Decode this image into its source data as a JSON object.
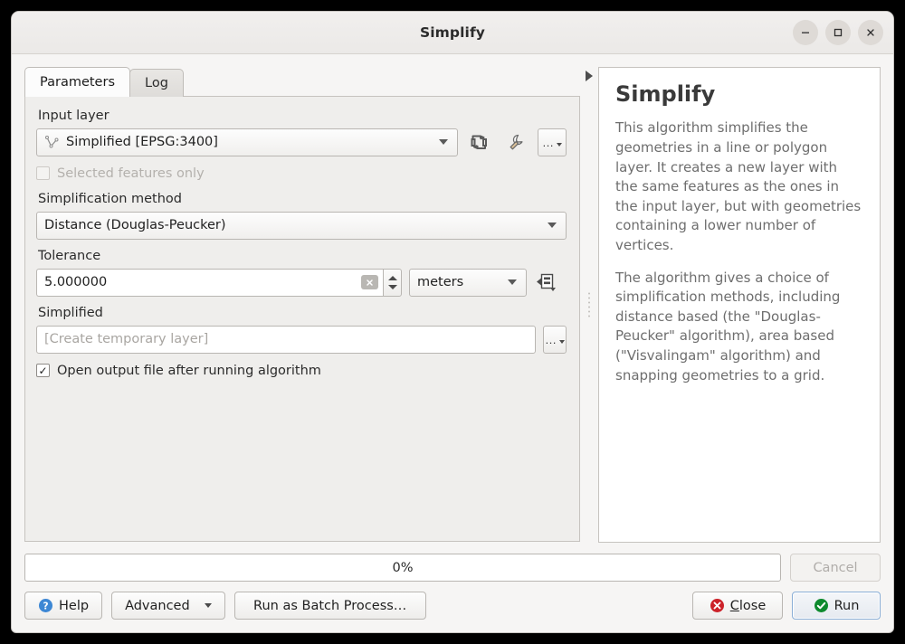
{
  "window": {
    "title": "Simplify",
    "controls": {
      "minimize": "–",
      "maximize": "□",
      "close": "✕"
    }
  },
  "tabs": [
    {
      "id": "parameters",
      "label": "Parameters",
      "active": true
    },
    {
      "id": "log",
      "label": "Log",
      "active": false
    }
  ],
  "parameters": {
    "input_layer": {
      "label": "Input layer",
      "value": "Simplified [EPSG:3400]",
      "layer_icon": "line-layer-icon",
      "buttons": {
        "iterate": "iterate-icon",
        "advanced": "wrench-icon",
        "browse": "…"
      }
    },
    "selected_features_only": {
      "label": "Selected features only",
      "checked": false,
      "disabled": true
    },
    "simplification_method": {
      "label": "Simplification method",
      "value": "Distance (Douglas-Peucker)"
    },
    "tolerance": {
      "label": "Tolerance",
      "value": "5.000000",
      "clear_glyph": "☒",
      "units": "meters",
      "data_defined_icon": "data-defined-override-icon"
    },
    "output": {
      "label": "Simplified",
      "placeholder": "[Create temporary layer]",
      "value": "",
      "browse_label": "…"
    },
    "open_output": {
      "label": "Open output file after running algorithm",
      "checked": true,
      "check_glyph": "✓"
    }
  },
  "splitter": {
    "collapse_icon": "collapse-right-arrow-icon"
  },
  "help": {
    "title": "Simplify",
    "paragraphs": [
      "This algorithm simplifies the geometries in a line or polygon layer. It creates a new layer with the same features as the ones in the input layer, but with geometries containing a lower number of vertices.",
      "The algorithm gives a choice of simplification methods, including distance based (the \"Douglas-Peucker\" algorithm), area based (\"Visvalingam\" algorithm) and snapping geometries to a grid."
    ]
  },
  "footer": {
    "progress": {
      "text": "0%",
      "percent": 0
    },
    "cancel": {
      "label": "Cancel",
      "disabled": true
    },
    "help_button": {
      "label": "Help",
      "icon": "help-circle-icon"
    },
    "advanced_button": {
      "label": "Advanced",
      "icon": "chevron-down-icon"
    },
    "batch_button": {
      "label": "Run as Batch Process…"
    },
    "close_button": {
      "label_prefix": "",
      "label_underline": "C",
      "label_rest": "lose",
      "icon": "close-circle-icon"
    },
    "run_button": {
      "label": "Run",
      "icon": "check-circle-icon",
      "is_default": true
    }
  },
  "colors": {
    "accent_blue": "#3d87d4",
    "error_red": "#cc2229",
    "success_green": "#0e8a2e",
    "window_bg": "#f6f5f4",
    "panel_bg": "#efeeec"
  }
}
